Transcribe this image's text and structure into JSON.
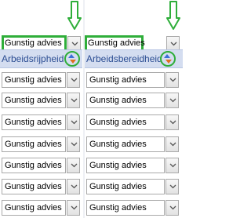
{
  "accent": {
    "highlight": "#2fae3a",
    "header_text": "#2c4e93",
    "header_bg": "#d4ddf0"
  },
  "icons": {
    "annotation_arrow": "arrow-down-icon",
    "sort": "sort-icon",
    "dropdown": "chevron-down-icon"
  },
  "columns": [
    {
      "header": "Arbeidsrijpheid",
      "filter_value": "Gunstig advies",
      "rows": [
        "Gunstig advies",
        "Gunstig advies",
        "Gunstig advies",
        "Gunstig advies",
        "Gunstig advies",
        "Gunstig advies",
        "Gunstig advies"
      ]
    },
    {
      "header": "Arbeidsbereidheid",
      "filter_value": "Gunstig advies",
      "rows": [
        "Gunstig advies",
        "Gunstig advies",
        "Gunstig advies",
        "Gunstig advies",
        "Gunstig advies",
        "Gunstig advies",
        "Gunstig advies"
      ]
    }
  ]
}
